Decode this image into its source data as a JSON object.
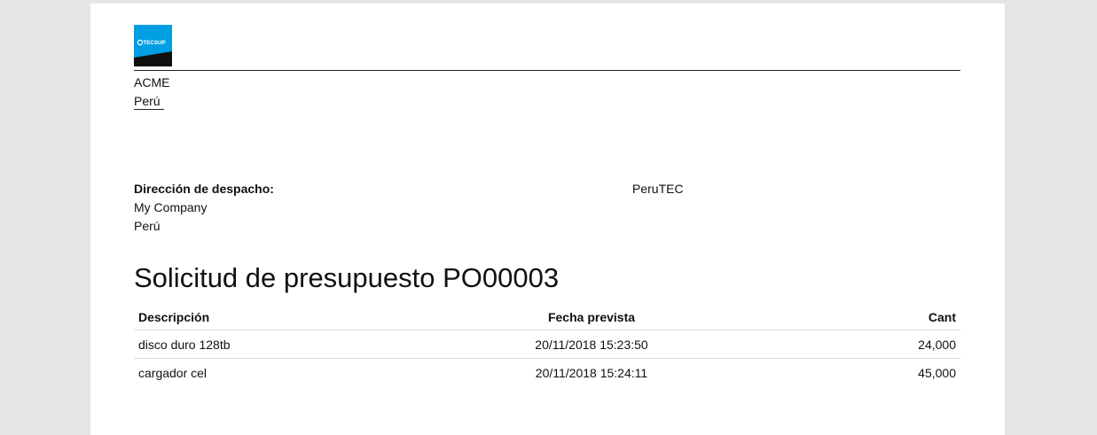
{
  "logo": {
    "text": "TECSUP",
    "icon": "tecsup-logo-icon",
    "colors": {
      "brand_blue": "#009fe3",
      "dark": "#111111"
    }
  },
  "company": {
    "name": "ACME",
    "country": "Perú"
  },
  "shipping": {
    "label": "Dirección de despacho:",
    "company": "My Company",
    "country": "Perú"
  },
  "vendor": {
    "name": "PeruTEC"
  },
  "document": {
    "title": "Solicitud de presupuesto PO00003"
  },
  "table": {
    "headers": {
      "description": "Descripción",
      "date": "Fecha prevista",
      "qty": "Cant"
    },
    "rows": [
      {
        "description": "disco duro 128tb",
        "date": "20/11/2018 15:23:50",
        "qty": "24,000"
      },
      {
        "description": "cargador cel",
        "date": "20/11/2018 15:24:11",
        "qty": "45,000"
      }
    ]
  }
}
